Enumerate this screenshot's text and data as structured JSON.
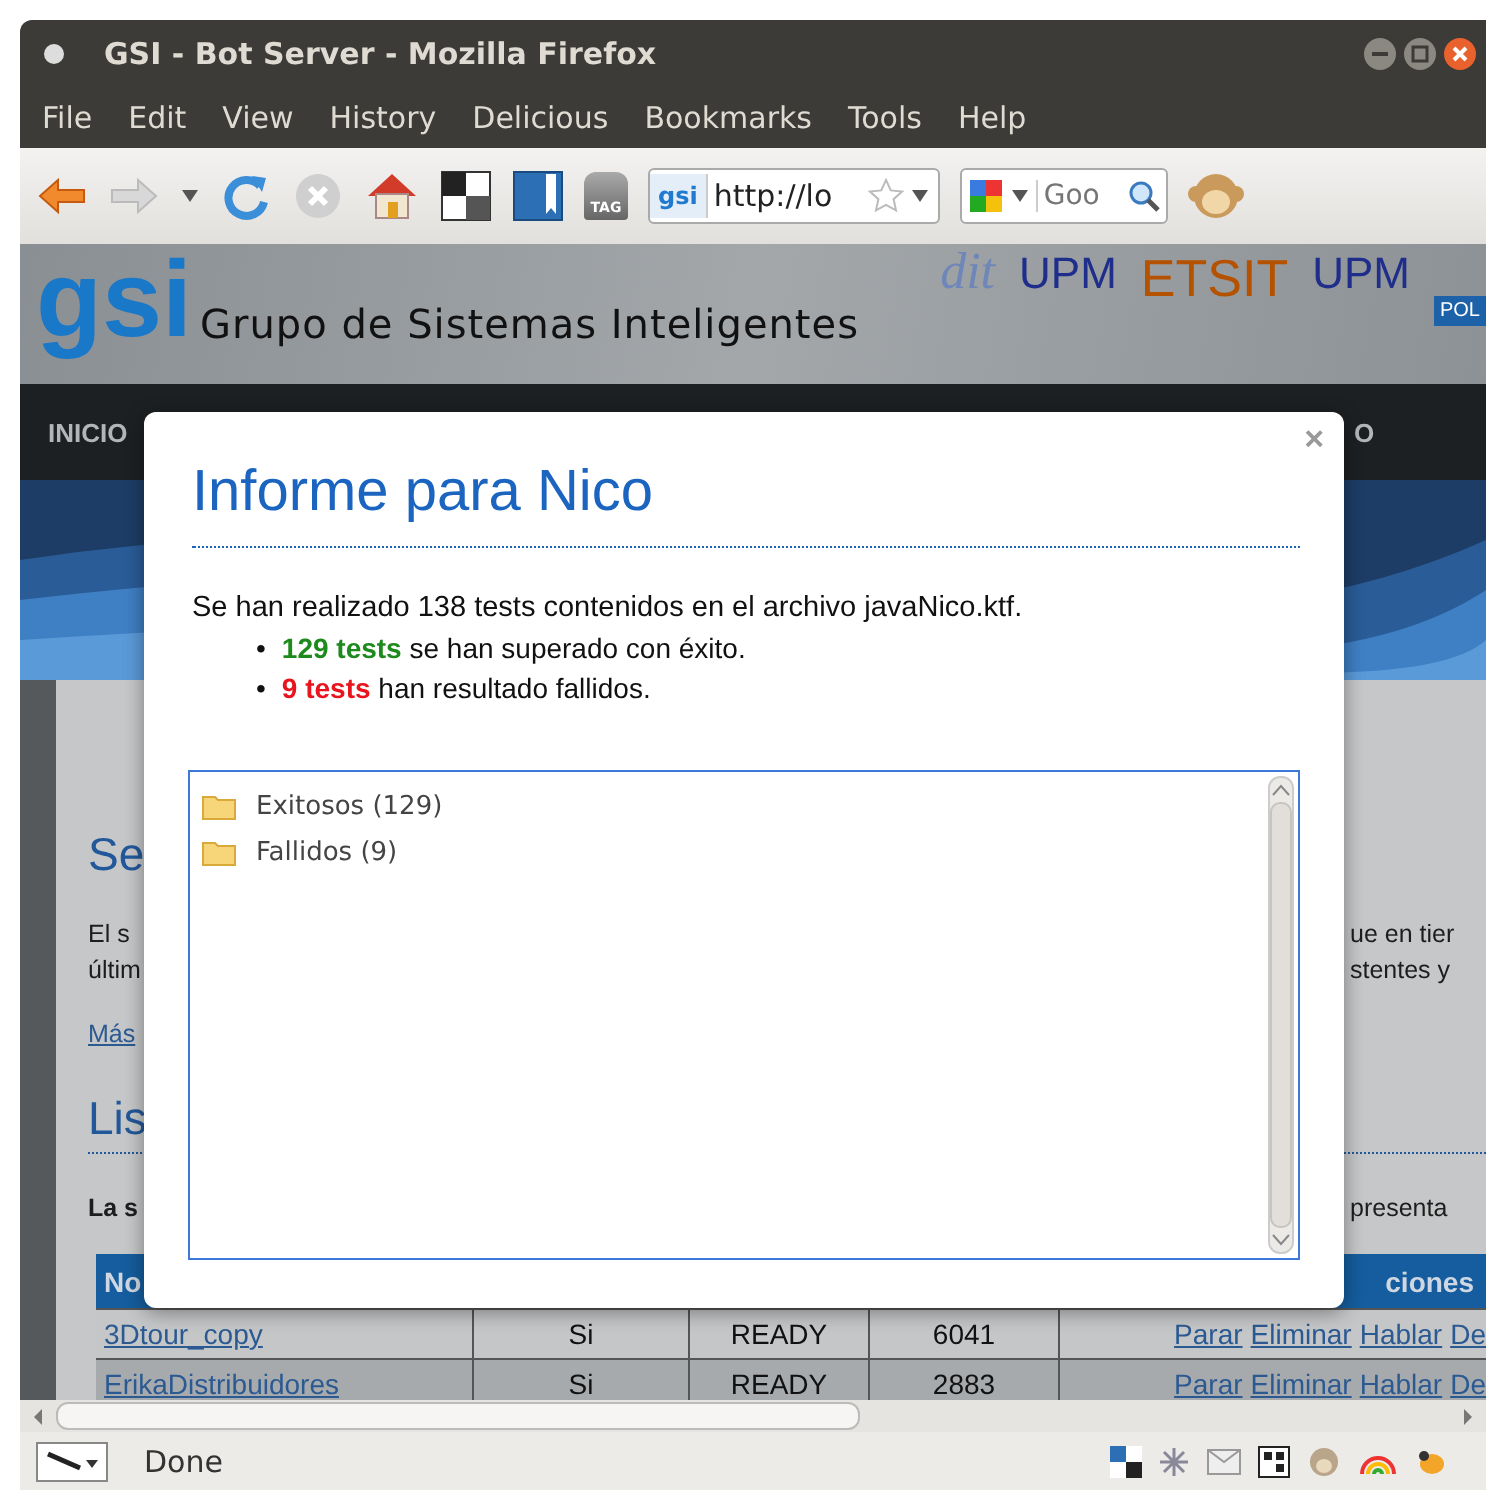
{
  "window": {
    "title": "GSI - Bot Server - Mozilla Firefox"
  },
  "menu": [
    "File",
    "Edit",
    "View",
    "History",
    "Delicious",
    "Bookmarks",
    "Tools",
    "Help"
  ],
  "toolbar": {
    "tag_label": "TAG",
    "site_badge": "gsi",
    "url": "http://lo",
    "search_placeholder": "Goo"
  },
  "page": {
    "header": {
      "logo": "gsi",
      "subtitle": "Grupo de Sistemas Inteligentes",
      "partners": [
        {
          "kind": "italic",
          "text": "dit"
        },
        {
          "kind": "plain",
          "text": "UPM"
        },
        {
          "kind": "orange",
          "text": "ETSIT"
        },
        {
          "kind": "plain",
          "text": "UPM"
        },
        {
          "kind": "tag",
          "text": "POL"
        }
      ]
    },
    "nav": [
      "INICIO",
      "O"
    ],
    "content": {
      "heading_1": "Se",
      "para_left": [
        "El s",
        "últim"
      ],
      "para_right": [
        "ue en tier",
        "stentes y"
      ],
      "link": "Más",
      "heading_2": "Lis",
      "intro_left": "La s",
      "intro_right": "presenta",
      "table": {
        "header_left": "No",
        "header_right": "ciones",
        "rows": [
          {
            "name": "3Dtour_copy",
            "active": "Si",
            "state": "READY",
            "port": "6041",
            "actions": [
              "Parar",
              "Eliminar",
              "Hablar",
              "De"
            ]
          },
          {
            "name": "ErikaDistribuidores",
            "active": "Si",
            "state": "READY",
            "port": "2883",
            "actions": [
              "Parar",
              "Eliminar",
              "Hablar",
              "De"
            ]
          }
        ]
      }
    }
  },
  "modal": {
    "close": "×",
    "title": "Informe para Nico",
    "summary": "Se han realizado 138 tests contenidos en el archivo javaNico.ktf.",
    "results": [
      {
        "kind": "passed",
        "bullet": "•",
        "lead": "129 tests",
        "text": " se han superado con éxito."
      },
      {
        "kind": "failed",
        "bullet": "•",
        "lead": "9 tests",
        "text": " han resultado fallidos."
      }
    ],
    "tree": [
      {
        "label": "Exitosos (129)"
      },
      {
        "label": "Fallidos (9)"
      }
    ]
  },
  "status_bar": {
    "text": "Done"
  }
}
